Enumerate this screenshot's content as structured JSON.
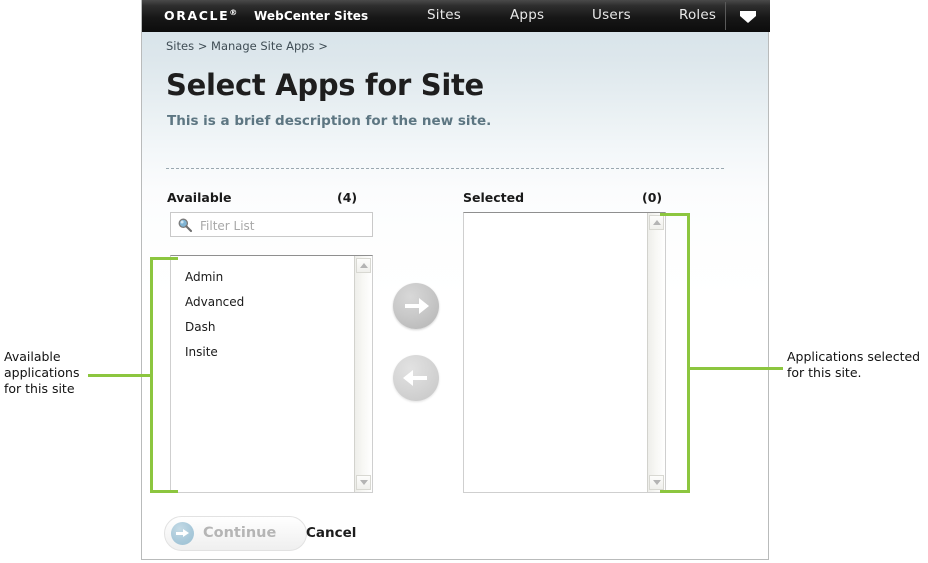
{
  "header": {
    "brand": "ORACLE",
    "brand_tm": "®",
    "product": "WebCenter Sites",
    "nav_items": [
      {
        "label": "Sites"
      },
      {
        "label": "Apps"
      },
      {
        "label": "Users"
      },
      {
        "label": "Roles"
      }
    ],
    "dropdown_icon": "chevron-down-icon"
  },
  "breadcrumb": "Sites > Manage Site Apps >",
  "page": {
    "title": "Select Apps for Site",
    "description": "This is a brief description for the new site."
  },
  "shuttle": {
    "available": {
      "label": "Available",
      "count": "(4)",
      "filter_placeholder": "Filter List",
      "filter_value": "",
      "search_icon": "search-icon",
      "items": [
        {
          "label": "Admin"
        },
        {
          "label": "Advanced"
        },
        {
          "label": "Dash"
        },
        {
          "label": "Insite"
        }
      ]
    },
    "selected": {
      "label": "Selected",
      "count": "(0)",
      "items": []
    },
    "move_right_icon": "arrow-right-icon",
    "move_left_icon": "arrow-left-icon"
  },
  "footer": {
    "continue_label": "Continue",
    "continue_icon": "arrow-right-circle-icon",
    "cancel_label": "Cancel"
  },
  "annotations": {
    "left": "Available applications for this site",
    "right": "Applications selected for this site."
  },
  "colors": {
    "annotation_green": "#8cc63f",
    "nav_bar_black": "#171717",
    "page_background_top": "#d4e1e8",
    "description_slate": "#5d7682",
    "continue_icon_blue": "#a9c9da"
  }
}
